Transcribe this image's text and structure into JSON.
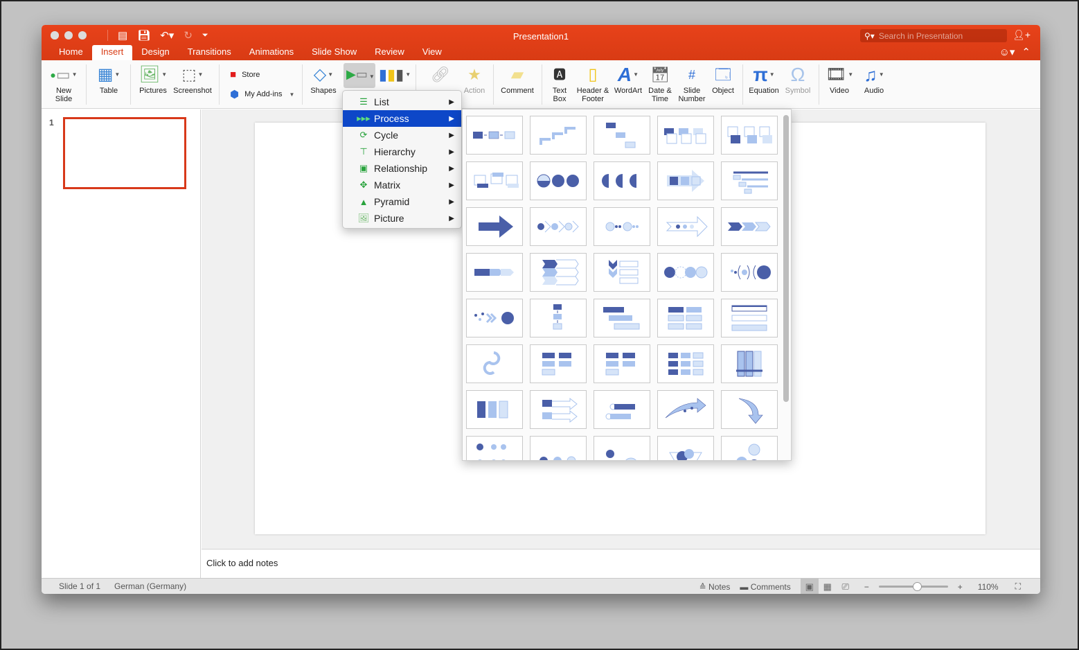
{
  "window": {
    "title": "Presentation1",
    "search_placeholder": "Search in Presentation"
  },
  "tabs": [
    {
      "label": "Home",
      "active": false
    },
    {
      "label": "Insert",
      "active": true
    },
    {
      "label": "Design",
      "active": false
    },
    {
      "label": "Transitions",
      "active": false
    },
    {
      "label": "Animations",
      "active": false
    },
    {
      "label": "Slide Show",
      "active": false
    },
    {
      "label": "Review",
      "active": false
    },
    {
      "label": "View",
      "active": false
    }
  ],
  "ribbon": {
    "new_slide": "New\nSlide",
    "table": "Table",
    "pictures": "Pictures",
    "screenshot": "Screenshot",
    "store": "Store",
    "my_addins": "My Add-ins",
    "shapes": "Shapes",
    "action": "Action",
    "comment": "Comment",
    "text_box": "Text\nBox",
    "header_footer": "Header &\nFooter",
    "wordart": "WordArt",
    "date_time": "Date &\nTime",
    "slide_number": "Slide\nNumber",
    "object": "Object",
    "equation": "Equation",
    "symbol": "Symbol",
    "video": "Video",
    "audio": "Audio"
  },
  "smartart_menu": {
    "items": [
      {
        "label": "List",
        "icon": "list-icon",
        "selected": false
      },
      {
        "label": "Process",
        "icon": "process-icon",
        "selected": true
      },
      {
        "label": "Cycle",
        "icon": "cycle-icon",
        "selected": false
      },
      {
        "label": "Hierarchy",
        "icon": "hierarchy-icon",
        "selected": false
      },
      {
        "label": "Relationship",
        "icon": "relationship-icon",
        "selected": false
      },
      {
        "label": "Matrix",
        "icon": "matrix-icon",
        "selected": false
      },
      {
        "label": "Pyramid",
        "icon": "pyramid-icon",
        "selected": false
      },
      {
        "label": "Picture",
        "icon": "picture-icon",
        "selected": false
      }
    ]
  },
  "gallery": {
    "layout_count_visible": 40,
    "accent_dark": "#4a5fa8",
    "accent_mid": "#a9c3ee",
    "accent_light": "#d6e4f8"
  },
  "thumbnails": [
    {
      "number": "1"
    }
  ],
  "notes": {
    "placeholder": "Click to add notes"
  },
  "status": {
    "slide": "Slide 1 of 1",
    "language": "German (Germany)",
    "notes": "Notes",
    "comments": "Comments",
    "zoom": "110%",
    "zoom_level_percent": 110
  },
  "colors": {
    "accent": "#d83b14",
    "menu_selection": "#0d47c8"
  }
}
